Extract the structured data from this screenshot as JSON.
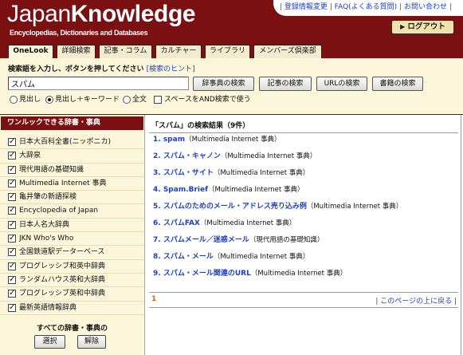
{
  "colors": {
    "brand": "#7a1012",
    "cream": "#fcf6da",
    "tab": "#f3ebcf",
    "link": "#1d3fc2",
    "accent": "#e35d00",
    "logout": "#efe2ae"
  },
  "brand": {
    "name_light": "Japan",
    "name_bold": "Knowledge",
    "tagline": "Encyclopedias, Dictionaries and Databases"
  },
  "top_links": {
    "separator": "|",
    "items": [
      "登録情報変更",
      "FAQ(よくある質問)",
      "お問い合わせ"
    ]
  },
  "logout": {
    "icon": "play-arrow-icon",
    "arrow": "▶",
    "label": "ログアウト"
  },
  "tabs": [
    {
      "label": "OneLook",
      "active": true
    },
    {
      "label": "詳細検索",
      "active": false
    },
    {
      "label": "記事・コラム",
      "active": false
    },
    {
      "label": "カルチャー",
      "active": false
    },
    {
      "label": "ライブラリ",
      "active": false
    },
    {
      "label": "メンバーズ倶楽部",
      "active": false
    }
  ],
  "search": {
    "prompt": "検索語を入力し、ボタンを押してください",
    "hint_link": "[検索のヒント]",
    "query": "スパム",
    "buttons": [
      "辞事典の検索",
      "記事の検索",
      "URLの検索",
      "書籍の検索"
    ],
    "options": [
      {
        "type": "radio",
        "label": "見出し",
        "checked": false
      },
      {
        "type": "radio",
        "label": "見出し＋キーワード",
        "checked": true
      },
      {
        "type": "radio",
        "label": "全文",
        "checked": false
      },
      {
        "type": "checkbox",
        "label": "スペースをAND検索で使う",
        "checked": false
      }
    ]
  },
  "sidebar": {
    "title": "ワンルックできる辞書・事典",
    "items": [
      {
        "label": "日本大百科全書(ニッポニカ)",
        "checked": true
      },
      {
        "label": "大辞泉",
        "checked": true
      },
      {
        "label": "現代用語の基礎知識",
        "checked": true
      },
      {
        "label": "Multimedia Internet 事典",
        "checked": true
      },
      {
        "label": "亀井肇の新語探検",
        "checked": true
      },
      {
        "label": "Encyclopedia of Japan",
        "checked": true
      },
      {
        "label": "日本人名大辞典",
        "checked": true
      },
      {
        "label": "JKN Who's Who",
        "checked": true
      },
      {
        "label": "全国鉄道駅データーベース",
        "checked": true
      },
      {
        "label": "プログレッシブ和英中辞典",
        "checked": true
      },
      {
        "label": "ランダムハウス英和大辞典",
        "checked": true
      },
      {
        "label": "プログレッシブ英和中辞典",
        "checked": true
      },
      {
        "label": "最新英語情報辞典",
        "checked": true
      }
    ],
    "all_label": "すべての辞書・事典の",
    "select_label": "選択",
    "clear_label": "解除"
  },
  "results": {
    "title": "「スパム」の検索結果（9件）",
    "items": [
      {
        "num": "1.",
        "title": "spam",
        "source": "（Multimedia Internet 事典）"
      },
      {
        "num": "2.",
        "title": "スパム・キャノン",
        "source": "（Multimedia Internet 事典）"
      },
      {
        "num": "3.",
        "title": "スパム・サイト",
        "source": "（Multimedia Internet 事典）"
      },
      {
        "num": "4.",
        "title": "Spam.Brief",
        "source": "（Multimedia Internet 事典）"
      },
      {
        "num": "5.",
        "title": "スパムのためのメール・アドレス売り込み例",
        "source": "（Multimedia Internet 事典）"
      },
      {
        "num": "6.",
        "title": "スパムFAX",
        "source": "（Multimedia Internet 事典）"
      },
      {
        "num": "7.",
        "title": "スパムメール／迷惑メール",
        "source": "（現代用語の基礎知識）"
      },
      {
        "num": "8.",
        "title": "スパム・メール",
        "source": "（Multimedia Internet 事典）"
      },
      {
        "num": "9.",
        "title": "スパム・メール関連のURL",
        "source": "（Multimedia Internet 事典）"
      }
    ],
    "page": "1",
    "separator": "|",
    "back_to_top": "このページの上に戻る"
  }
}
